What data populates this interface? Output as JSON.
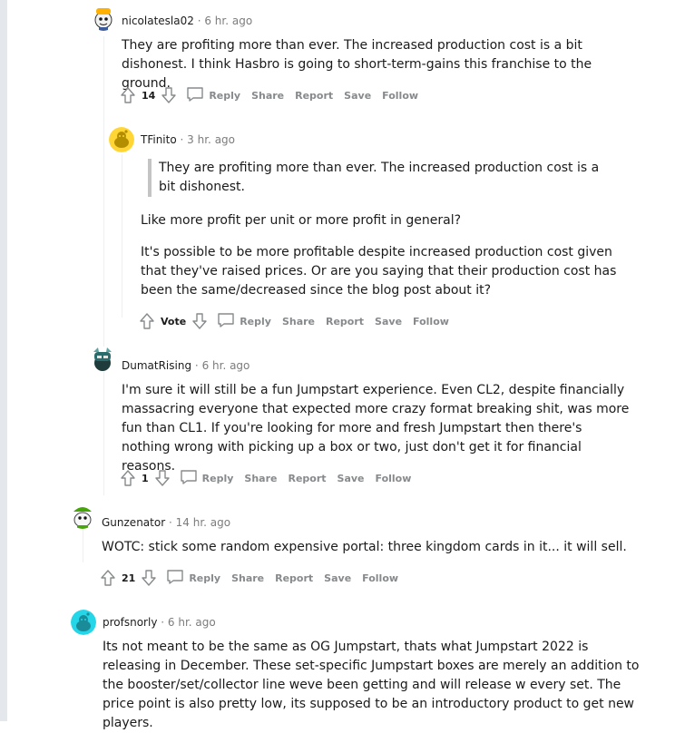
{
  "colors": {
    "meta": "#7c7c7c",
    "action": "#878a8c",
    "thread": "#edeff1"
  },
  "comments": [
    {
      "username": "nicolatesla02",
      "time": "6 hr. ago",
      "avatar_icon": "reddit-snoo-avatar-icon",
      "paragraphs": [
        "They are profiting more than ever. The increased production cost is a bit dishonest. I think Hasbro is going to short-term-gains this franchise to the ground."
      ],
      "score": "14"
    },
    {
      "username": "TFinito",
      "time": "3 hr. ago",
      "avatar_icon": "reddit-snoo-avatar-icon",
      "quote": "They are profiting more than ever. The increased production cost is a bit dishonest.",
      "paragraphs": [
        "Like more profit per unit or more profit in general?",
        "It's possible to be more profitable despite increased production cost given that they've raised prices. Or are you saying that their production cost has been the same/decreased since the blog post about it?"
      ],
      "score": "Vote"
    },
    {
      "username": "DumatRising",
      "time": "6 hr. ago",
      "avatar_icon": "reddit-snoo-avatar-icon",
      "paragraphs": [
        "I'm sure it will still be a fun Jumpstart experience. Even CL2, despite financially massacring everyone that expected more crazy format breaking shit, was more fun than CL1. If you're looking for more and fresh Jumpstart then there's nothing wrong with picking up a box or two, just don't get it for financial reasons."
      ],
      "score": "1"
    },
    {
      "username": "Gunzenator",
      "time": "14 hr. ago",
      "avatar_icon": "reddit-snoo-avatar-icon",
      "paragraphs": [
        "WOTC: stick some random expensive portal: three kingdom cards in it... it will sell."
      ],
      "score": "21"
    },
    {
      "username": "profsnorly",
      "time": "6 hr. ago",
      "avatar_icon": "reddit-snoo-avatar-icon",
      "paragraphs": [
        "Its not meant to be the same as OG Jumpstart, thats what Jumpstart 2022 is releasing in December. These set-specific Jumpstart boxes are merely an addition to the booster/set/collector line weve been getting and will release w every set. The price point is also pretty low, its supposed to be an introductory product to get new players."
      ]
    }
  ],
  "actions": {
    "reply": "Reply",
    "share": "Share",
    "report": "Report",
    "save": "Save",
    "follow": "Follow"
  },
  "separator": "·"
}
